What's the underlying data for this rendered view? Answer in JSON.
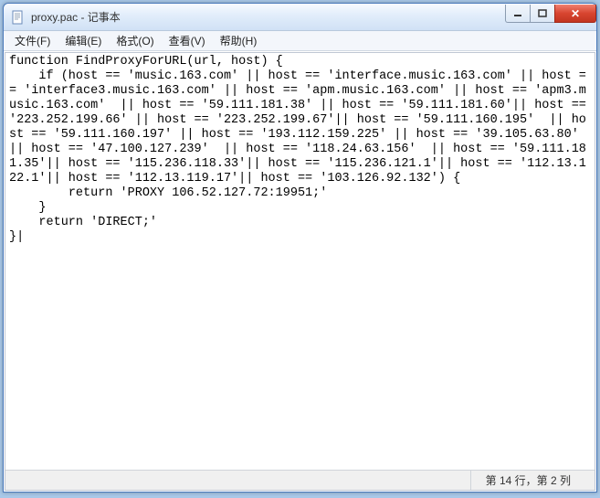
{
  "window": {
    "title": "proxy.pac - 记事本"
  },
  "menubar": {
    "file": "文件(F)",
    "edit": "编辑(E)",
    "format": "格式(O)",
    "view": "查看(V)",
    "help": "帮助(H)"
  },
  "editor": {
    "content": "function FindProxyForURL(url, host) {\n    if (host == 'music.163.com' || host == 'interface.music.163.com' || host == 'interface3.music.163.com' || host == 'apm.music.163.com' || host == 'apm3.music.163.com'  || host == '59.111.181.38' || host == '59.111.181.60'|| host == '223.252.199.66' || host == '223.252.199.67'|| host == '59.111.160.195'  || host == '59.111.160.197' || host == '193.112.159.225' || host == '39.105.63.80'  || host == '47.100.127.239'  || host == '118.24.63.156'  || host == '59.111.181.35'|| host == '115.236.118.33'|| host == '115.236.121.1'|| host == '112.13.122.1'|| host == '112.13.119.17'|| host == '103.126.92.132') {\n        return 'PROXY 106.52.127.72:19951;'\n    }\n    return 'DIRECT;'\n}|"
  },
  "statusbar": {
    "position": "第 14 行，第 2 列"
  }
}
